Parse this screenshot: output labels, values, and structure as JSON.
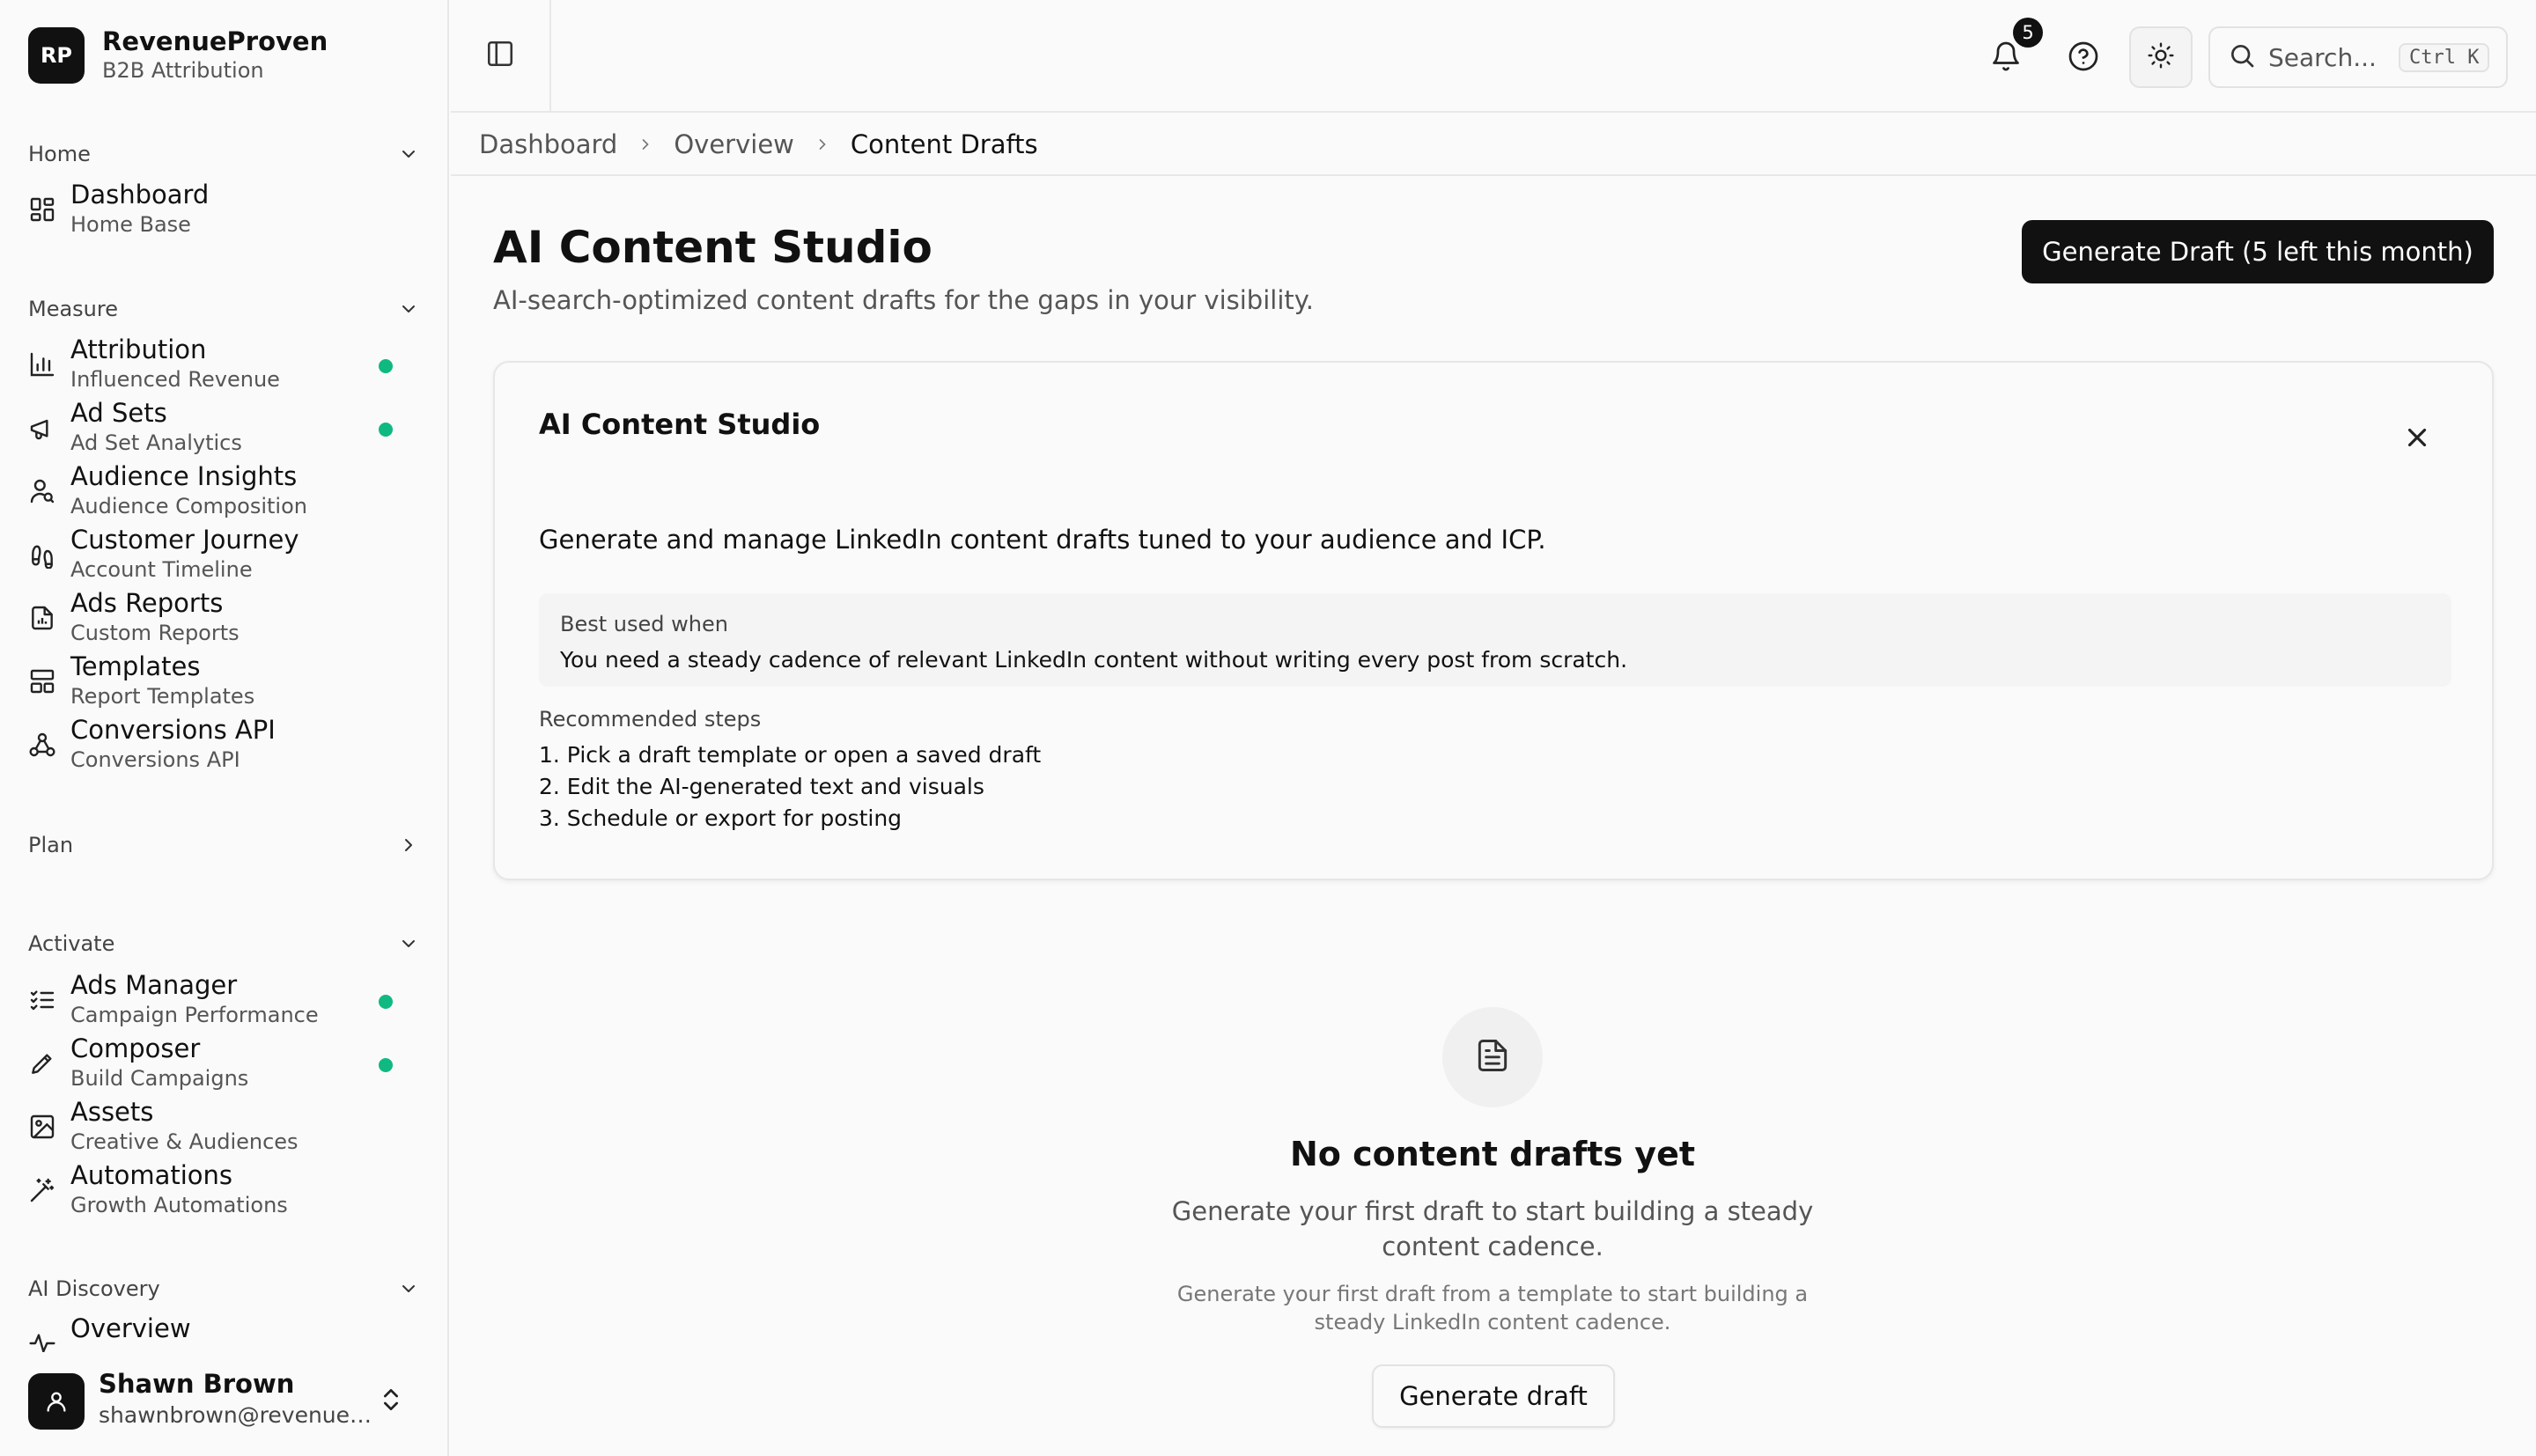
{
  "brand": {
    "logo_text": "RP",
    "name": "RevenueProven",
    "subtitle": "B2B Attribution"
  },
  "sidebar": {
    "groups": [
      {
        "label": "Home",
        "expanded": true,
        "items": [
          {
            "title": "Dashboard",
            "subtitle": "Home Base",
            "icon": "grid-icon",
            "dot": false
          }
        ]
      },
      {
        "label": "Measure",
        "expanded": true,
        "items": [
          {
            "title": "Attribution",
            "subtitle": "Influenced Revenue",
            "icon": "bar-chart-icon",
            "dot": true
          },
          {
            "title": "Ad Sets",
            "subtitle": "Ad Set Analytics",
            "icon": "megaphone-icon",
            "dot": true
          },
          {
            "title": "Audience Insights",
            "subtitle": "Audience Composition",
            "icon": "user-search-icon",
            "dot": false
          },
          {
            "title": "Customer Journey",
            "subtitle": "Account Timeline",
            "icon": "footprints-icon",
            "dot": false
          },
          {
            "title": "Ads Reports",
            "subtitle": "Custom Reports",
            "icon": "file-chart-icon",
            "dot": false
          },
          {
            "title": "Templates",
            "subtitle": "Report Templates",
            "icon": "layout-icon",
            "dot": false
          },
          {
            "title": "Conversions API",
            "subtitle": "Conversions API",
            "icon": "webhook-icon",
            "dot": false
          }
        ]
      },
      {
        "label": "Plan",
        "expanded": false,
        "items": []
      },
      {
        "label": "Activate",
        "expanded": true,
        "items": [
          {
            "title": "Ads Manager",
            "subtitle": "Campaign Performance",
            "icon": "list-checks-icon",
            "dot": true
          },
          {
            "title": "Composer",
            "subtitle": "Build Campaigns",
            "icon": "pen-icon",
            "dot": true
          },
          {
            "title": "Assets",
            "subtitle": "Creative & Audiences",
            "icon": "image-icon",
            "dot": false
          },
          {
            "title": "Automations",
            "subtitle": "Growth Automations",
            "icon": "wand-icon",
            "dot": false
          }
        ]
      },
      {
        "label": "AI Discovery",
        "expanded": true,
        "items": [
          {
            "title": "Overview",
            "subtitle": "",
            "icon": "activity-icon",
            "dot": false
          }
        ]
      }
    ]
  },
  "user": {
    "name": "Shawn Brown",
    "email": "shawnbrown@revenueproven.com"
  },
  "topbar": {
    "notification_count": "5",
    "search_placeholder": "Search...",
    "search_shortcut": "Ctrl K"
  },
  "breadcrumb": [
    "Dashboard",
    "Overview",
    "Content Drafts"
  ],
  "page": {
    "title": "AI Content Studio",
    "subtitle": "AI-search-optimized content drafts for the gaps in your visibility.",
    "primary_button": "Generate Draft (5 left this month)"
  },
  "info_card": {
    "title": "AI Content Studio",
    "description": "Generate and manage LinkedIn content drafts tuned to your audience and ICP.",
    "best_used_label": "Best used when",
    "best_used_text": "You need a steady cadence of relevant LinkedIn content without writing every post from scratch.",
    "steps_label": "Recommended steps",
    "steps": [
      "1. Pick a draft template or open a saved draft",
      "2. Edit the AI-generated text and visuals",
      "3. Schedule or export for posting"
    ]
  },
  "empty_state": {
    "title": "No content drafts yet",
    "description": "Generate your first draft to start building a steady content cadence.",
    "hint": "Generate your first draft from a template to start building a steady LinkedIn content cadence.",
    "button": "Generate draft"
  },
  "colors": {
    "accent": "#111111",
    "status_dot": "#10b981",
    "background": "#fafafa"
  }
}
